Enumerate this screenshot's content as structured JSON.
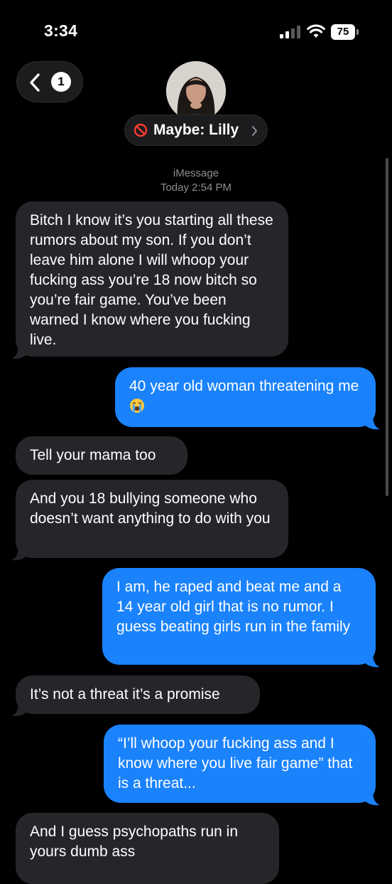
{
  "status_bar": {
    "time": "3:34",
    "battery_percent": "75"
  },
  "header": {
    "back_badge": "1",
    "contact_name": "Maybe: Lilly"
  },
  "thread": {
    "service": "iMessage",
    "timestamp": "Today 2:54 PM"
  },
  "messages": [
    {
      "direction": "incoming",
      "text": "Bitch I know it’s you starting all these rumors about my son. If you don’t leave him alone I will whoop your fucking ass you’re 18 now bitch so you’re fair game. You’ve been warned I know where you fucking live."
    },
    {
      "direction": "outgoing",
      "text": "40 year old woman threatening me",
      "emoji": "loudly-crying-face-emoji"
    },
    {
      "direction": "incoming",
      "text": "Tell your mama too"
    },
    {
      "direction": "incoming",
      "text": "And you 18 bullying someone who doesn’t want anything to do with you"
    },
    {
      "direction": "outgoing",
      "text": "I am, he raped and beat me and a 14 year old girl that is no rumor. I guess beating girls run in the family"
    },
    {
      "direction": "incoming",
      "text": "It’s not a threat it’s a promise"
    },
    {
      "direction": "outgoing",
      "text": "“I’ll whoop your fucking ass and I know where you live fair game” that is a threat..."
    },
    {
      "direction": "incoming",
      "text": "And I guess psychopaths run in yours dumb ass"
    }
  ],
  "colors": {
    "incoming_bubble": "#26252a",
    "outgoing_bubble": "#1a82fb",
    "background": "#000000",
    "block_icon": "#ff3b30"
  }
}
